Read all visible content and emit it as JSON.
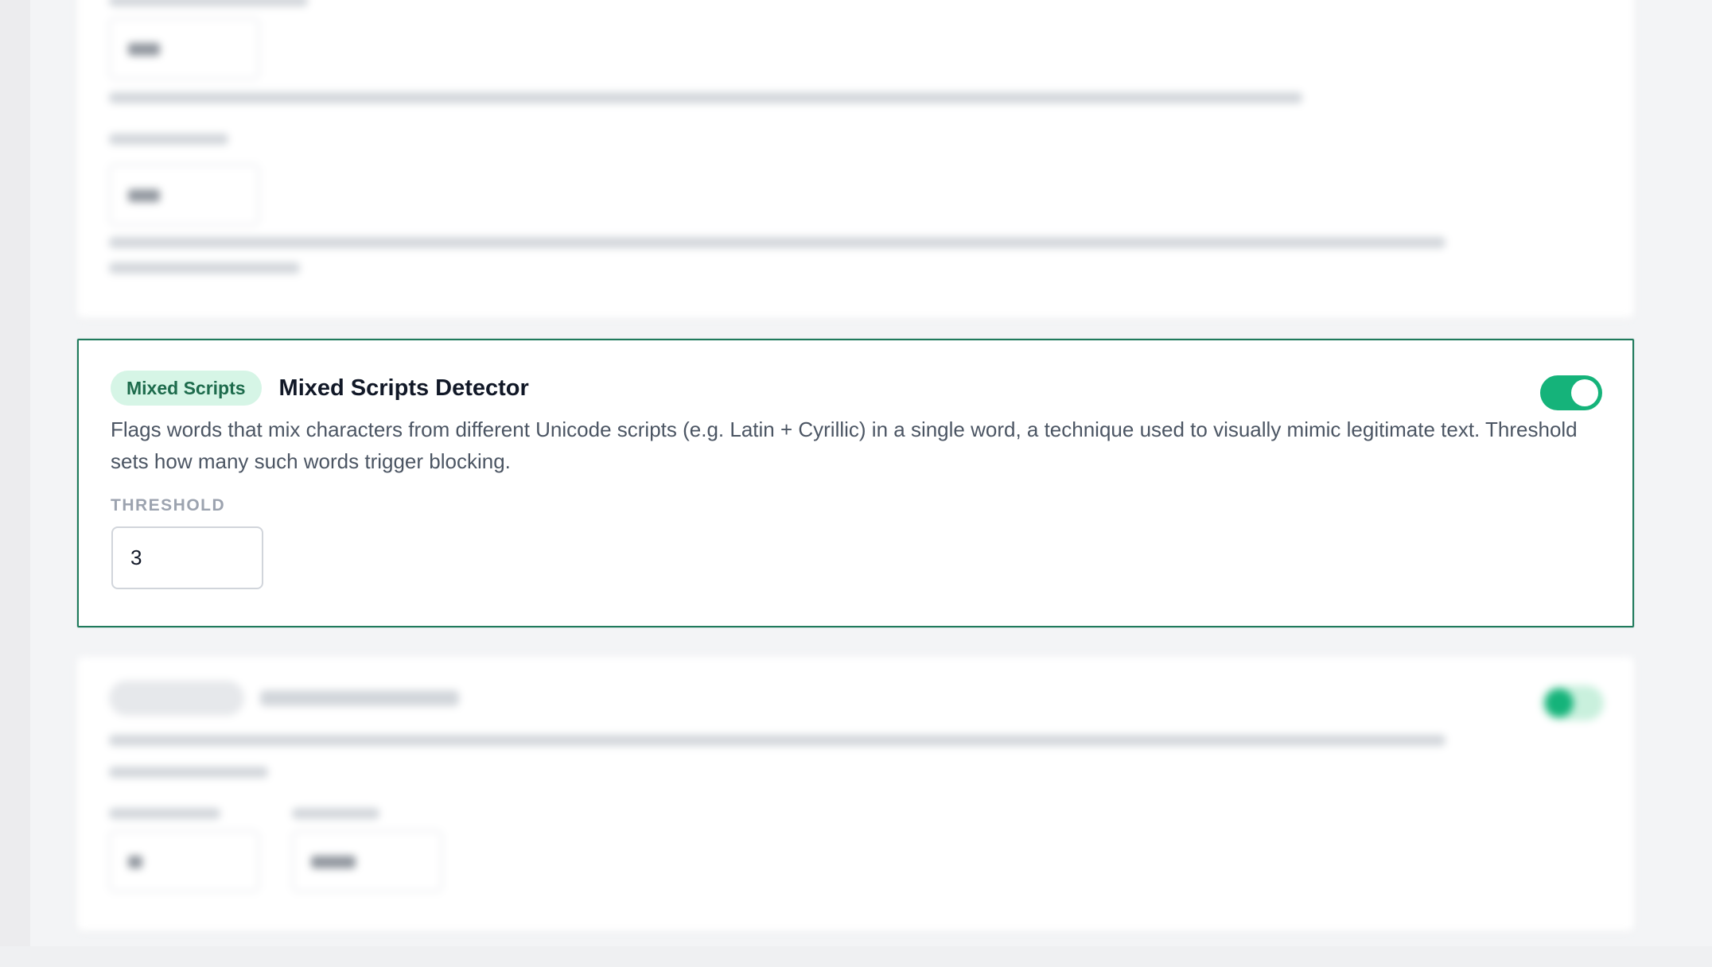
{
  "detector": {
    "badge": "Mixed Scripts",
    "title": "Mixed Scripts Detector",
    "enabled": true,
    "description": "Flags words that mix characters from different Unicode scripts (e.g. Latin + Cyrillic) in a single word, a technique used to visually mimic legitimate text. Threshold sets how many such words trigger blocking.",
    "threshold_label": "THRESHOLD",
    "threshold_value": "3"
  },
  "colors": {
    "accent": "#15b37a",
    "focus_border": "#1f7a5c",
    "badge_bg": "#d6f5e6",
    "badge_text": "#1d6b4c"
  },
  "icons": {
    "toggle": "toggle-switch-icon"
  }
}
